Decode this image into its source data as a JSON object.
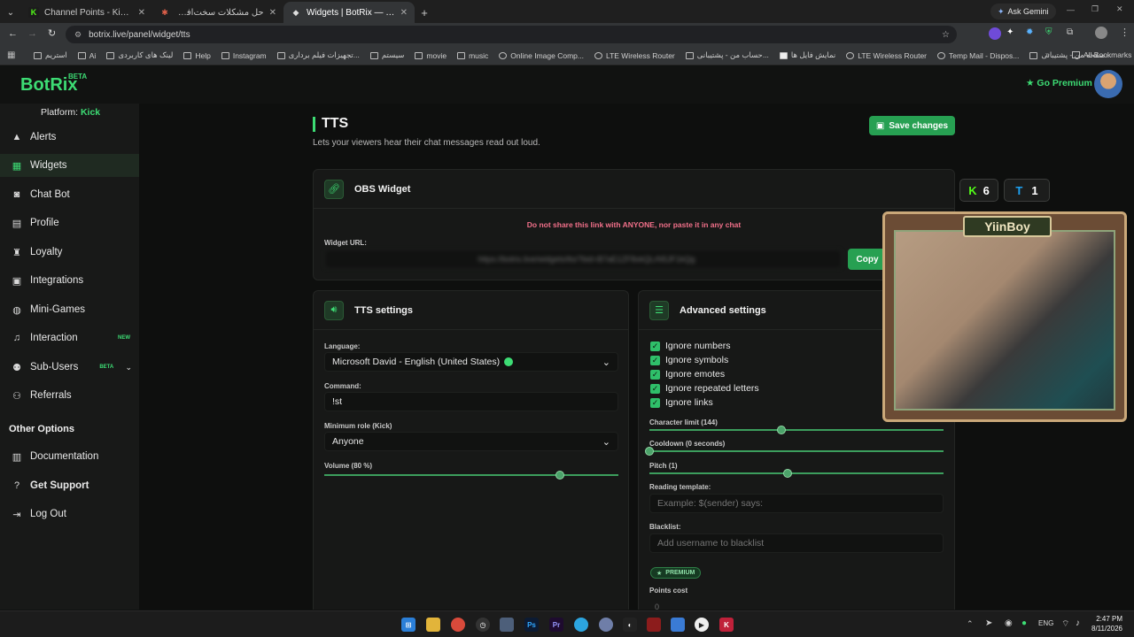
{
  "browser": {
    "tabs": [
      {
        "title": "Channel Points - Kick Dashboard",
        "favicon": "K",
        "active": false
      },
      {
        "title": "حل مشکلات سخت‌افزاری و فنی ا...",
        "favicon": "✱",
        "active": false
      },
      {
        "title": "Widgets | BotRix — Cloud Stream",
        "favicon": "◆",
        "active": true
      }
    ],
    "ask_gemini": "Ask Gemini",
    "url": "botrix.live/panel/widget/tts",
    "bookmarks": [
      "استریم",
      "Ai",
      "لینک های کاربردی",
      "Help",
      "Instagram",
      "تجهیزات فیلم برداری...",
      "سیستم",
      "movie",
      "music",
      "Online Image Comp...",
      "LTE Wireless Router",
      "حساب من - پشتیبانی...",
      "نمایش فایل ها",
      "LTE Wireless Router",
      "Temp Mail - Dispos...",
      "صفحه من - پشتیبانی..."
    ],
    "all_bookmarks": "All Bookmarks"
  },
  "app": {
    "logo": "BotRix",
    "logo_badge": "BETA",
    "go_premium": "Go Premium",
    "platform_label": "Platform:",
    "platform_value": "Kick"
  },
  "sidebar": {
    "items": [
      {
        "label": "Alerts",
        "icon": "alert-triangle-icon"
      },
      {
        "label": "Widgets",
        "icon": "grid-icon",
        "active": true
      },
      {
        "label": "Chat Bot",
        "icon": "robot-icon"
      },
      {
        "label": "Profile",
        "icon": "id-card-icon"
      },
      {
        "label": "Loyalty",
        "icon": "trophy-icon"
      },
      {
        "label": "Integrations",
        "icon": "integration-icon"
      },
      {
        "label": "Mini-Games",
        "icon": "gamepad-icon"
      },
      {
        "label": "Interaction",
        "icon": "music-icon",
        "badge": "NEW"
      },
      {
        "label": "Sub-Users",
        "icon": "users-icon",
        "badge": "BETA"
      },
      {
        "label": "Referrals",
        "icon": "referral-icon"
      }
    ],
    "other_heading": "Other Options",
    "other_items": [
      {
        "label": "Documentation",
        "icon": "book-icon"
      },
      {
        "label": "Get Support",
        "icon": "question-icon"
      },
      {
        "label": "Log Out",
        "icon": "logout-icon"
      }
    ]
  },
  "page": {
    "title": "TTS",
    "subtitle": "Lets your viewers hear their chat messages read out loud.",
    "save_button": "Save changes"
  },
  "obs": {
    "title": "OBS Widget",
    "warning": "Do not share this link with ANYONE, nor paste it in any chat",
    "url_label": "Widget URL:",
    "url_value": "https://botrix.live/widgets/tts/?bid=B7aE1ZF8xkQLrN5JF1kQg",
    "copy": "Copy"
  },
  "tts": {
    "title": "TTS settings",
    "language_label": "Language:",
    "language_value": "Microsoft David - English (United States)",
    "command_label": "Command:",
    "command_value": "!st",
    "role_label": "Minimum role (Kick)",
    "role_value": "Anyone",
    "volume_label": "Volume (80 %)",
    "volume": 0.8
  },
  "advanced": {
    "title": "Advanced settings",
    "checks": [
      "Ignore numbers",
      "Ignore symbols",
      "Ignore emotes",
      "Ignore repeated letters",
      "Ignore links"
    ],
    "char_limit_label": "Character limit (144)",
    "char_limit_fraction": 0.45,
    "cooldown_label": "Cooldown (0 seconds)",
    "cooldown_fraction": 0.0,
    "pitch_label": "Pitch (1)",
    "pitch_fraction": 0.47,
    "template_label": "Reading template:",
    "template_placeholder": "Example: $(sender) says:",
    "blacklist_label": "Blacklist:",
    "blacklist_placeholder": "Add username to blacklist",
    "premium_badge": "PREMIUM",
    "points_label": "Points cost",
    "points_value": "0"
  },
  "stream": {
    "kick_count": "6",
    "twitter_count": "1",
    "streamer_name": "YiinBoy"
  },
  "taskbar": {
    "lang": "ENG",
    "time": "2:47 PM",
    "date": "8/11/2026"
  },
  "colors": {
    "accent": "#3ddc74",
    "warning": "#f2708a",
    "save": "#27a052"
  }
}
